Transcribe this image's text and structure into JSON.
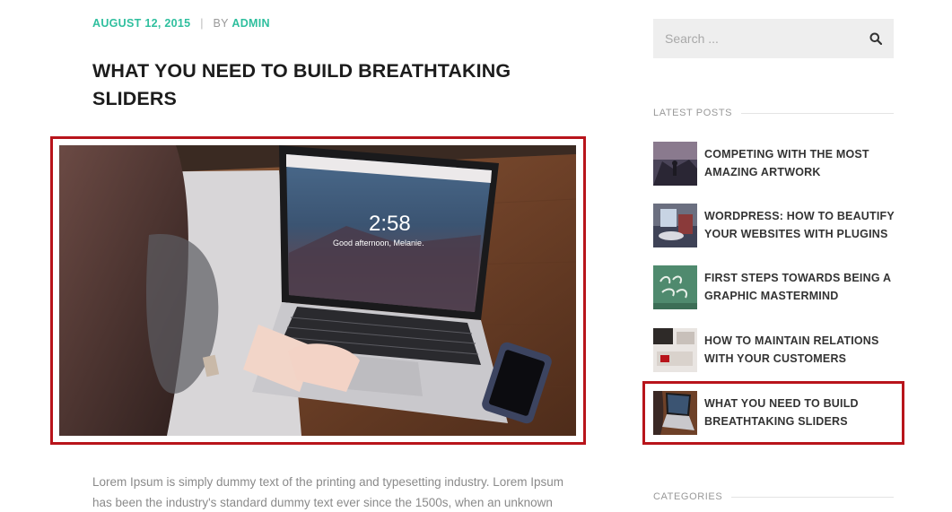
{
  "post": {
    "date": "AUGUST 12, 2015",
    "separator": "|",
    "by": "BY",
    "author": "ADMIN",
    "title": "WHAT YOU NEED TO BUILD BREATHTAKING SLIDERS",
    "laptop_clock": "2:58",
    "laptop_greeting": "Good afternoon, Melanie.",
    "excerpt": "Lorem Ipsum is simply dummy text of the printing and typesetting industry. Lorem Ipsum has been the industry's standard dummy text ever since the 1500s, when an unknown printer"
  },
  "sidebar": {
    "search": {
      "placeholder": "Search ..."
    },
    "latest_posts_title": "LATEST POSTS",
    "latest_posts": [
      {
        "title": "COMPETING WITH THE MOST AMAZING ARTWORK"
      },
      {
        "title": "WORDPRESS: HOW TO BEAUTIFY YOUR WEBSITES WITH PLUGINS"
      },
      {
        "title": "FIRST STEPS TOWARDS BEING A GRAPHIC MASTERMIND"
      },
      {
        "title": "HOW TO MAINTAIN RELATIONS WITH YOUR CUSTOMERS"
      },
      {
        "title": "WHAT YOU NEED TO BUILD BREATHTAKING SLIDERS"
      }
    ],
    "categories_title": "CATEGORIES"
  },
  "colors": {
    "accent": "#2fbf9e",
    "highlight": "#b8141b"
  }
}
